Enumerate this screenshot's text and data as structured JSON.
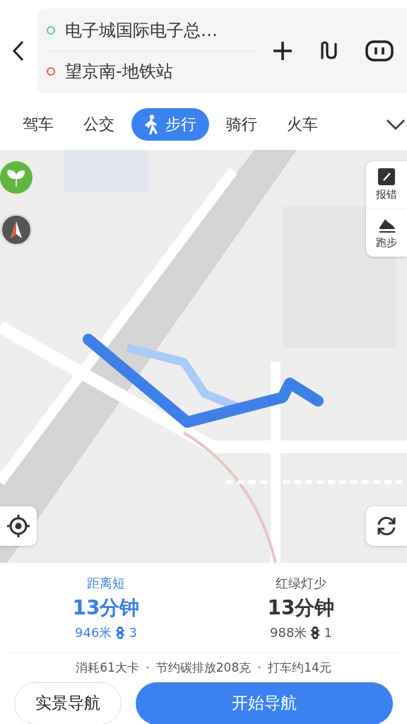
{
  "search": {
    "origin": "电子城国际电子总…",
    "destination": "望京南-地铁站"
  },
  "tabs": [
    {
      "label": "驾车",
      "selected": false,
      "kind": "text"
    },
    {
      "label": "公交",
      "selected": false,
      "kind": "text"
    },
    {
      "label": "步行",
      "selected": true,
      "kind": "walk"
    },
    {
      "label": "骑行",
      "selected": false,
      "kind": "text"
    },
    {
      "label": "火车",
      "selected": false,
      "kind": "text"
    }
  ],
  "map": {
    "tools": [
      {
        "label": "报错",
        "kind": "report"
      },
      {
        "label": "跑步",
        "kind": "run"
      }
    ]
  },
  "routes": [
    {
      "tag": "距离短",
      "time": "13分钟",
      "distance": "946米",
      "lights": "3",
      "selected": true
    },
    {
      "tag": "红绿灯少",
      "time": "13分钟",
      "distance": "988米",
      "lights": "1",
      "selected": false
    }
  ],
  "stats": [
    "消耗61大卡",
    "节约碳排放208克",
    "打车约14元"
  ],
  "buttons": [
    {
      "label": "实景导航",
      "kind": "secondary"
    },
    {
      "label": "开始导航",
      "kind": "primary"
    }
  ]
}
